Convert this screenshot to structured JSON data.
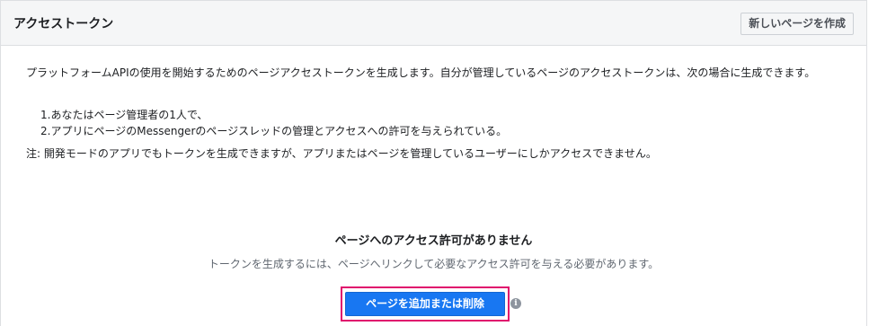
{
  "header": {
    "title": "アクセストークン",
    "create_page_label": "新しいページを作成"
  },
  "content": {
    "description": "プラットフォームAPIの使用を開始するためのページアクセストークンを生成します。自分が管理しているページのアクセストークンは、次の場合に生成できます。",
    "conditions": [
      "1.あなたはページ管理者の1人で、",
      "2.アプリにページのMessengerのページスレッドの管理とアクセスへの許可を与えられている。"
    ],
    "note": "注: 開発モードのアプリでもトークンを生成できますが、アプリまたはページを管理しているユーザーにしかアクセスできません。"
  },
  "empty_state": {
    "title": "ページへのアクセス許可がありません",
    "subtitle": "トークンを生成するには、ページへリンクして必要なアクセス許可を与える必要があります。",
    "add_remove_label": "ページを追加または削除",
    "info_icon": "info-icon"
  },
  "colors": {
    "primary_button": "#1877f2",
    "highlight_border": "#e0106d",
    "header_bg": "#f5f6f7"
  }
}
